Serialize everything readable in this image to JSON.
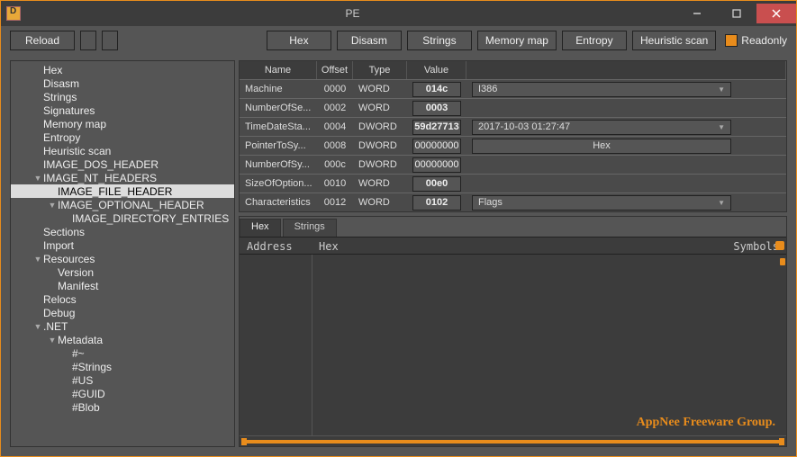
{
  "window": {
    "title": "PE"
  },
  "toolbar": {
    "reload": "Reload",
    "hex": "Hex",
    "disasm": "Disasm",
    "strings": "Strings",
    "memorymap": "Memory map",
    "entropy": "Entropy",
    "heuristic": "Heuristic scan",
    "readonly": "Readonly"
  },
  "tree": [
    {
      "label": "Hex",
      "lvl": 1
    },
    {
      "label": "Disasm",
      "lvl": 1
    },
    {
      "label": "Strings",
      "lvl": 1
    },
    {
      "label": "Signatures",
      "lvl": 1
    },
    {
      "label": "Memory map",
      "lvl": 1
    },
    {
      "label": "Entropy",
      "lvl": 1
    },
    {
      "label": "Heuristic scan",
      "lvl": 1
    },
    {
      "label": "IMAGE_DOS_HEADER",
      "lvl": 1
    },
    {
      "label": "IMAGE_NT_HEADERS",
      "lvl": 1,
      "exp": true
    },
    {
      "label": "IMAGE_FILE_HEADER",
      "lvl": 2,
      "selected": true
    },
    {
      "label": "IMAGE_OPTIONAL_HEADER",
      "lvl": 2,
      "exp": true
    },
    {
      "label": "IMAGE_DIRECTORY_ENTRIES",
      "lvl": 3
    },
    {
      "label": "Sections",
      "lvl": 1
    },
    {
      "label": "Import",
      "lvl": 1
    },
    {
      "label": "Resources",
      "lvl": 1,
      "exp": true
    },
    {
      "label": "Version",
      "lvl": 2
    },
    {
      "label": "Manifest",
      "lvl": 2
    },
    {
      "label": "Relocs",
      "lvl": 1
    },
    {
      "label": "Debug",
      "lvl": 1
    },
    {
      "label": ".NET",
      "lvl": 1,
      "exp": true
    },
    {
      "label": "Metadata",
      "lvl": 2,
      "exp": true
    },
    {
      "label": "#~",
      "lvl": 3
    },
    {
      "label": "#Strings",
      "lvl": 3
    },
    {
      "label": "#US",
      "lvl": 3
    },
    {
      "label": "#GUID",
      "lvl": 3
    },
    {
      "label": "#Blob",
      "lvl": 3
    }
  ],
  "grid": {
    "headers": {
      "name": "Name",
      "offset": "Offset",
      "type": "Type",
      "value": "Value"
    },
    "rows": [
      {
        "name": "Machine",
        "offset": "0000",
        "type": "WORD",
        "value": "014c",
        "extra": {
          "kind": "select",
          "text": "I386"
        }
      },
      {
        "name": "NumberOfSe...",
        "offset": "0002",
        "type": "WORD",
        "value": "0003"
      },
      {
        "name": "TimeDateSta...",
        "offset": "0004",
        "type": "DWORD",
        "value": "59d27713",
        "extra": {
          "kind": "datetime",
          "text": "2017-10-03 01:27:47"
        }
      },
      {
        "name": "PointerToSy...",
        "offset": "0008",
        "type": "DWORD",
        "value": "00000000",
        "plain": true,
        "extra": {
          "kind": "button",
          "text": "Hex"
        }
      },
      {
        "name": "NumberOfSy...",
        "offset": "000c",
        "type": "DWORD",
        "value": "00000000",
        "plain": true
      },
      {
        "name": "SizeOfOption...",
        "offset": "0010",
        "type": "WORD",
        "value": "00e0"
      },
      {
        "name": "Characteristics",
        "offset": "0012",
        "type": "WORD",
        "value": "0102",
        "extra": {
          "kind": "select",
          "text": "Flags"
        }
      }
    ]
  },
  "hexpanel": {
    "tabs": [
      "Hex",
      "Strings"
    ],
    "header": {
      "c1": "Address",
      "c2": "Hex",
      "c3": "Symbols"
    },
    "watermark": "AppNee Freeware Group."
  }
}
